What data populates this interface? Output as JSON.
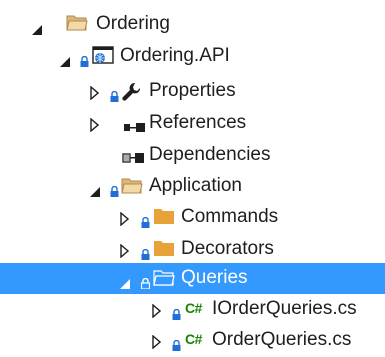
{
  "tree": {
    "ordering": {
      "label": "Ordering"
    },
    "ordering_api": {
      "label": "Ordering.API"
    },
    "properties": {
      "label": "Properties"
    },
    "references": {
      "label": "References"
    },
    "dependencies": {
      "label": "Dependencies"
    },
    "application": {
      "label": "Application"
    },
    "commands": {
      "label": "Commands"
    },
    "decorators": {
      "label": "Decorators"
    },
    "queries": {
      "label": "Queries"
    },
    "iorderqueries": {
      "label": "IOrderQueries.cs",
      "lang_badge": "C#"
    },
    "orderqueries": {
      "label": "OrderQueries.cs",
      "lang_badge": "C#"
    }
  },
  "colors": {
    "selection": "#3399ff",
    "lock_blue": "#1f6fd6",
    "csharp_green": "#178600",
    "folder_beige": "#dcb67a",
    "folder_gold": "#e8a23a",
    "wrench_dark": "#1e1e1e"
  }
}
